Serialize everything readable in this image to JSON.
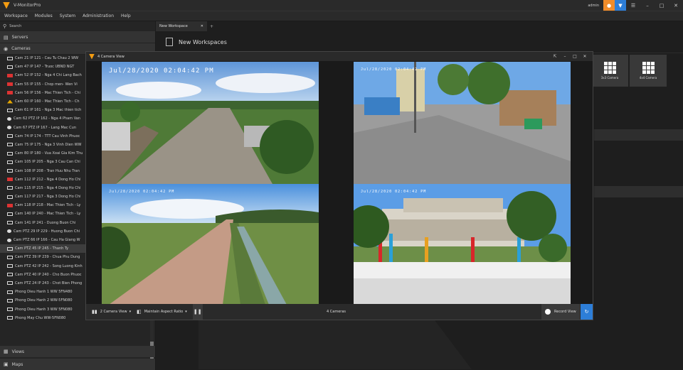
{
  "app": {
    "title": "V-MonitorPro",
    "user": "admin"
  },
  "menu": [
    "Workspace",
    "Modules",
    "System",
    "Administration",
    "Help"
  ],
  "sidebar": {
    "search_placeholder": "Search",
    "servers_label": "Servers",
    "cameras_label": "Cameras",
    "views_label": "Views",
    "maps_label": "Maps",
    "cameras": [
      {
        "label": "Cam 21 IP 121 - Cau Tu Chau 2 WW",
        "status": "ok"
      },
      {
        "label": "Cam 47 IP 147 - Truoc UBND NGT",
        "status": "ok"
      },
      {
        "label": "Cam 52 IP 152 - Nga 4 Chi Lang Bach",
        "status": "err"
      },
      {
        "label": "Cam 55 IP 155 - Chop men- Wen Vi",
        "status": "err"
      },
      {
        "label": "Cam 56 IP 156 - Mac Thien Tich - Chi",
        "status": "err"
      },
      {
        "label": "Cam 60 IP 160 - Mac Thien Tich - Ch",
        "status": "warn"
      },
      {
        "label": "Cam 61 IP 161 - Nga 3 Mac thien tich",
        "status": "ok"
      },
      {
        "label": "Cam 62 PTZ IP 162 - Nga 4 Pham Van",
        "status": "ptz"
      },
      {
        "label": "Cam 67 PTZ IP 167 - Lang Mac Cun",
        "status": "ptz"
      },
      {
        "label": "Cam 74 IP 174 - TTT Cau Vinh Phuoc",
        "status": "ok"
      },
      {
        "label": "Cam 75 IP 175 - Nga 3 Vinh Dien WW",
        "status": "ok"
      },
      {
        "label": "Cam 80 IP 180 - Vua Xoai Gia Kim Thu",
        "status": "ok"
      },
      {
        "label": "Cam 105 IP 205 - Nga 3 Cau Can Chi",
        "status": "ok"
      },
      {
        "label": "Cam 108 IP 208 - Tran Huu Nhu Tran",
        "status": "ok"
      },
      {
        "label": "Cam 112 IP 212 - Nga 4 Dong Ho Chi",
        "status": "err"
      },
      {
        "label": "Cam 115 IP 215 - Nga 4 Dong Ho Chi",
        "status": "ok"
      },
      {
        "label": "Cam 117 IP 217 - Nga 3 Dong Ho Chi",
        "status": "ok"
      },
      {
        "label": "Cam 118 IP 218 - Mac Thien Tich - Ly",
        "status": "err"
      },
      {
        "label": "Cam 140 IP 240 - Mac Thien Tich - Ly",
        "status": "ok"
      },
      {
        "label": "Cam 141 IP 241 - Duong Buon Chi",
        "status": "ok"
      },
      {
        "label": "Cam PTZ 29 IP 229 - Huong Buon Chi",
        "status": "ptz"
      },
      {
        "label": "Cam PTZ 66 IP 166 - Cau Ha Giang W",
        "status": "ptz"
      },
      {
        "label": "Cam PTZ 45 IP 245 - Thanh Ty",
        "status": "ok",
        "selected": true
      },
      {
        "label": "Cam PTZ 39 IP 239 - Chua Phu Dung",
        "status": "ok"
      },
      {
        "label": "Cam PTZ 42 IP 242 - Song Luong Kinh",
        "status": "ok"
      },
      {
        "label": "Cam PTZ 40 IP 240 - Cho Buon Phuoc",
        "status": "ok"
      },
      {
        "label": "Cam PTZ 24 IP 243 - Chot Bien Phong",
        "status": "ok"
      },
      {
        "label": "Phong Dieu Hanh 1 WW 5FN480",
        "status": "ok"
      },
      {
        "label": "Phong Dieu Hanh 2 WW-5FN080",
        "status": "ok"
      },
      {
        "label": "Phong Dieu Hanh 3 WW 5FN080",
        "status": "ok"
      },
      {
        "label": "Phong May Chu WW-5FN080",
        "status": "ok"
      }
    ]
  },
  "workspace": {
    "tab_label": "New Workspace",
    "title": "New Workspaces",
    "tiles": [
      "3x3 Camera",
      "4x4 Camera"
    ]
  },
  "viewer": {
    "title": "4 Camera View",
    "feeds": [
      {
        "timestamp": "Jul/28/2020 02:04:42 PM"
      },
      {
        "timestamp": "Jul/28/2020 02:04:42 PM"
      },
      {
        "timestamp": "Jul/28/2020 02:04:42 PM"
      },
      {
        "timestamp": "Jul/28/2020 02:04:42 PM"
      }
    ],
    "footer": {
      "layout_label": "2 Camera View",
      "aspect_label": "Maintain Aspect Ratio",
      "count_label": "4 Cameras",
      "record_label": "Record View"
    }
  }
}
